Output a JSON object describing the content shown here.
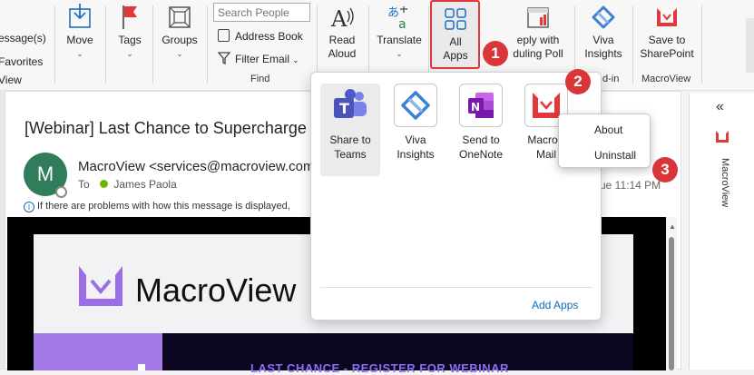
{
  "ribbon": {
    "left_items": [
      "essage(s)",
      "Favorites",
      "View"
    ],
    "move": "Move",
    "tags": "Tags",
    "groups": "Groups",
    "search_placeholder": "Search People",
    "address_book": "Address Book",
    "filter_email": "Filter Email",
    "find_label": "Find",
    "read_aloud": [
      "Read",
      "Aloud"
    ],
    "translate": "Translate",
    "all_apps": [
      "All",
      "Apps"
    ],
    "reply_poll": [
      "eply with",
      "duling Poll"
    ],
    "viva_insights": [
      "Viva",
      "Insights"
    ],
    "addin_label": "d-in",
    "save_sharepoint": [
      "Save to",
      "SharePoint"
    ],
    "macroview_label": "MacroView"
  },
  "email": {
    "subject": "[Webinar] Last Chance to Supercharge",
    "avatar_letter": "M",
    "sender": "MacroView <services@macroview.com",
    "to_label": "To",
    "to_name": "James Paola",
    "info": "If there are problems with how this message is displayed,",
    "time": "ue 11:14 PM",
    "logo_text": "MacroView",
    "banner_text": "LAST CHANCE - REGISTER FOR WEBINAR"
  },
  "flyout": {
    "apps": [
      {
        "label": [
          "Share to",
          "Teams"
        ]
      },
      {
        "label": [
          "Viva",
          "Insights"
        ]
      },
      {
        "label": [
          "Send to",
          "OneNote"
        ]
      },
      {
        "label": [
          "MacroV",
          "Mail"
        ]
      }
    ],
    "add_apps": "Add Apps"
  },
  "context_menu": {
    "about": "About",
    "uninstall": "Uninstall"
  },
  "badges": [
    "1",
    "2",
    "3"
  ],
  "side_panel": {
    "collapse": "«",
    "title": "MacroView"
  },
  "colors": {
    "badge": "#d9363a",
    "highlight_border": "#e0363a",
    "link": "#0f6cbd",
    "macroview_purple": "#a47be6"
  }
}
